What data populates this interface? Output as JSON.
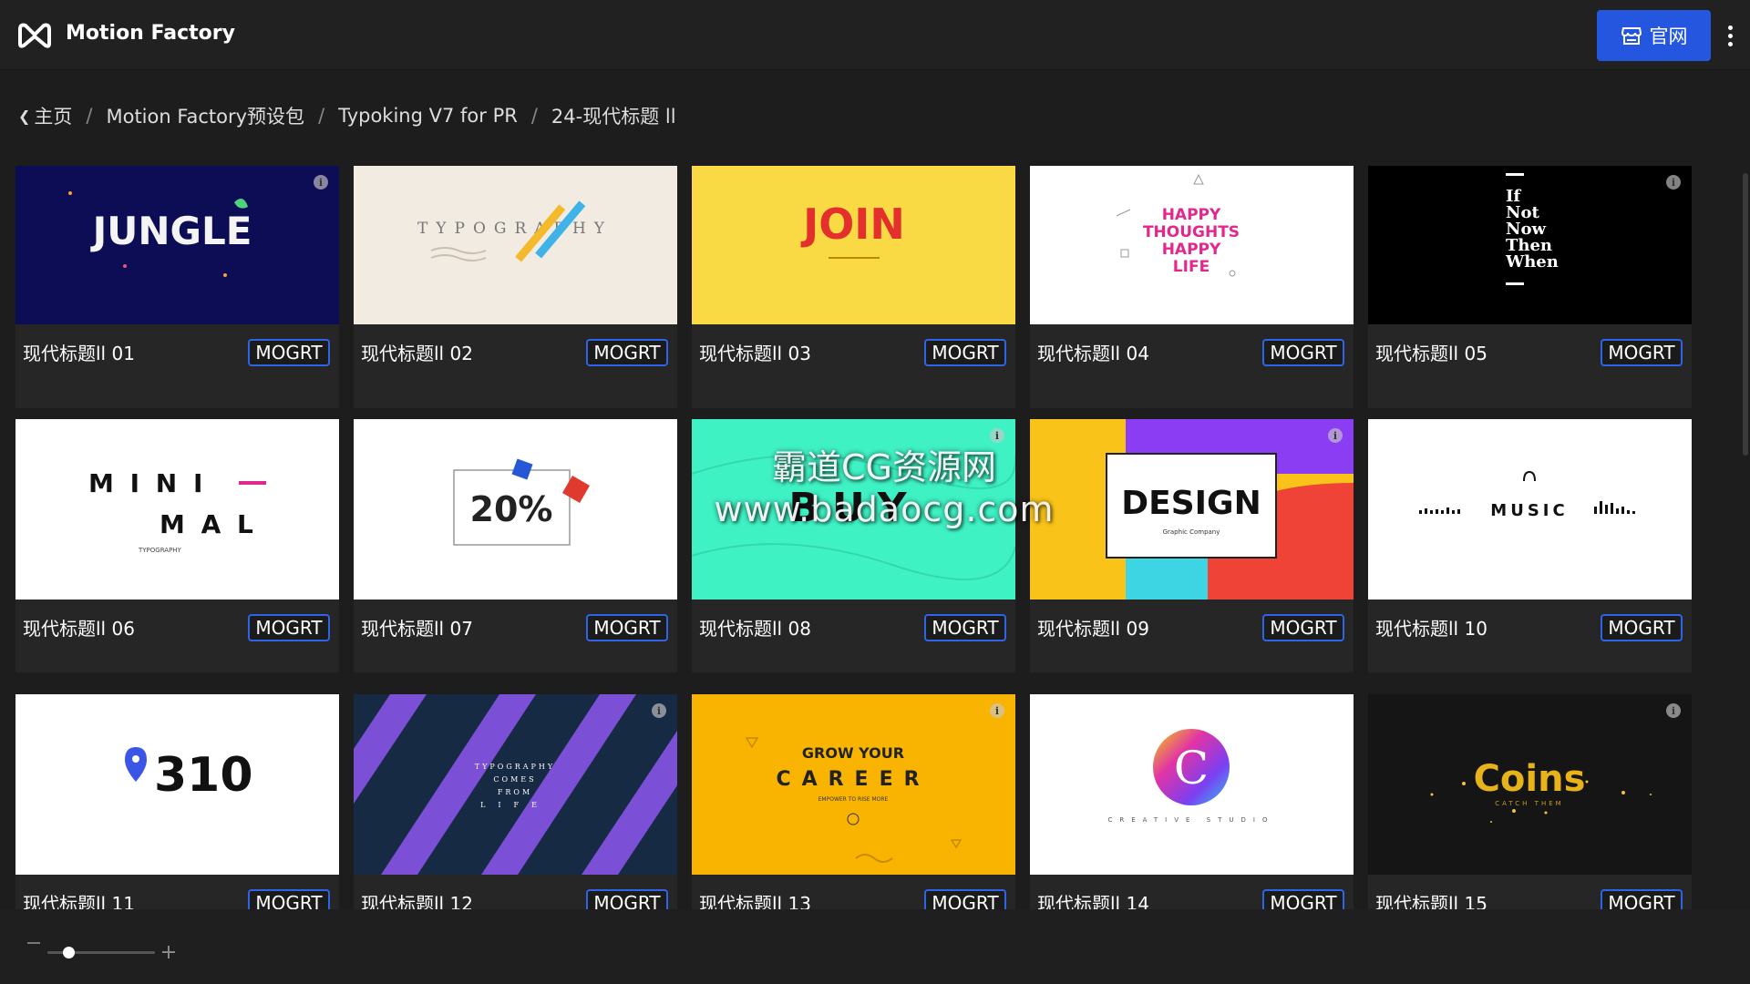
{
  "app": {
    "title": "Motion Factory",
    "site_button": "官网"
  },
  "breadcrumb": [
    "主页",
    "Motion Factory预设包",
    "Typoking V7 for PR",
    "24-现代标题 ll"
  ],
  "badge_label": "MOGRT",
  "watermark": {
    "line1": "霸道CG资源网",
    "line2": "www.badaocg.com"
  },
  "cards": [
    {
      "title": "现代标题ll 01",
      "thumb": "jungle"
    },
    {
      "title": "现代标题ll 02",
      "thumb": "typography"
    },
    {
      "title": "现代标题ll 03",
      "thumb": "join"
    },
    {
      "title": "现代标题ll 04",
      "thumb": "happy-thoughts"
    },
    {
      "title": "现代标题ll 05",
      "thumb": "if-not-now"
    },
    {
      "title": "现代标题ll 06",
      "thumb": "minimal"
    },
    {
      "title": "现代标题ll 07",
      "thumb": "twenty-percent"
    },
    {
      "title": "现代标题ll 08",
      "thumb": "buy"
    },
    {
      "title": "现代标题ll 09",
      "thumb": "design"
    },
    {
      "title": "现代标题ll 10",
      "thumb": "music"
    },
    {
      "title": "现代标题ll 11",
      "thumb": "pin-310"
    },
    {
      "title": "现代标题ll 12",
      "thumb": "typography-life"
    },
    {
      "title": "现代标题ll 13",
      "thumb": "grow-career"
    },
    {
      "title": "现代标题ll 14",
      "thumb": "creative-c"
    },
    {
      "title": "现代标题ll 15",
      "thumb": "coins"
    }
  ],
  "thumb_text": {
    "jungle": "JUNGLE",
    "typography": "TYPOGRAPHY",
    "join": "JOIN",
    "happy": [
      "HAPPY",
      "THOUGHTS",
      "HAPPY",
      "LIFE"
    ],
    "ifnot": [
      "If",
      "Not",
      "Now",
      "Then",
      "When"
    ],
    "minimal": [
      "M I N I",
      "M A L",
      "TYPOGRAPHY"
    ],
    "percent": "20%",
    "buy": "BUY",
    "design": [
      "DESIGN",
      "Graphic Company"
    ],
    "music": "MUSIC",
    "pin_number": "310",
    "life": [
      "TYPOGRAPHY",
      "COMES",
      "FROM",
      "LIFE"
    ],
    "career": [
      "GROW YOUR",
      "CAREER",
      "EMPOWER TO RISE MORE"
    ],
    "creative": [
      "C",
      "CREATIVE STUDIO"
    ],
    "coins": [
      "Coins",
      "CATCH THEM"
    ]
  },
  "zoom": {
    "level": 0.2
  },
  "colors": {
    "accent": "#2456e0",
    "badge_border": "#2f63e8"
  }
}
